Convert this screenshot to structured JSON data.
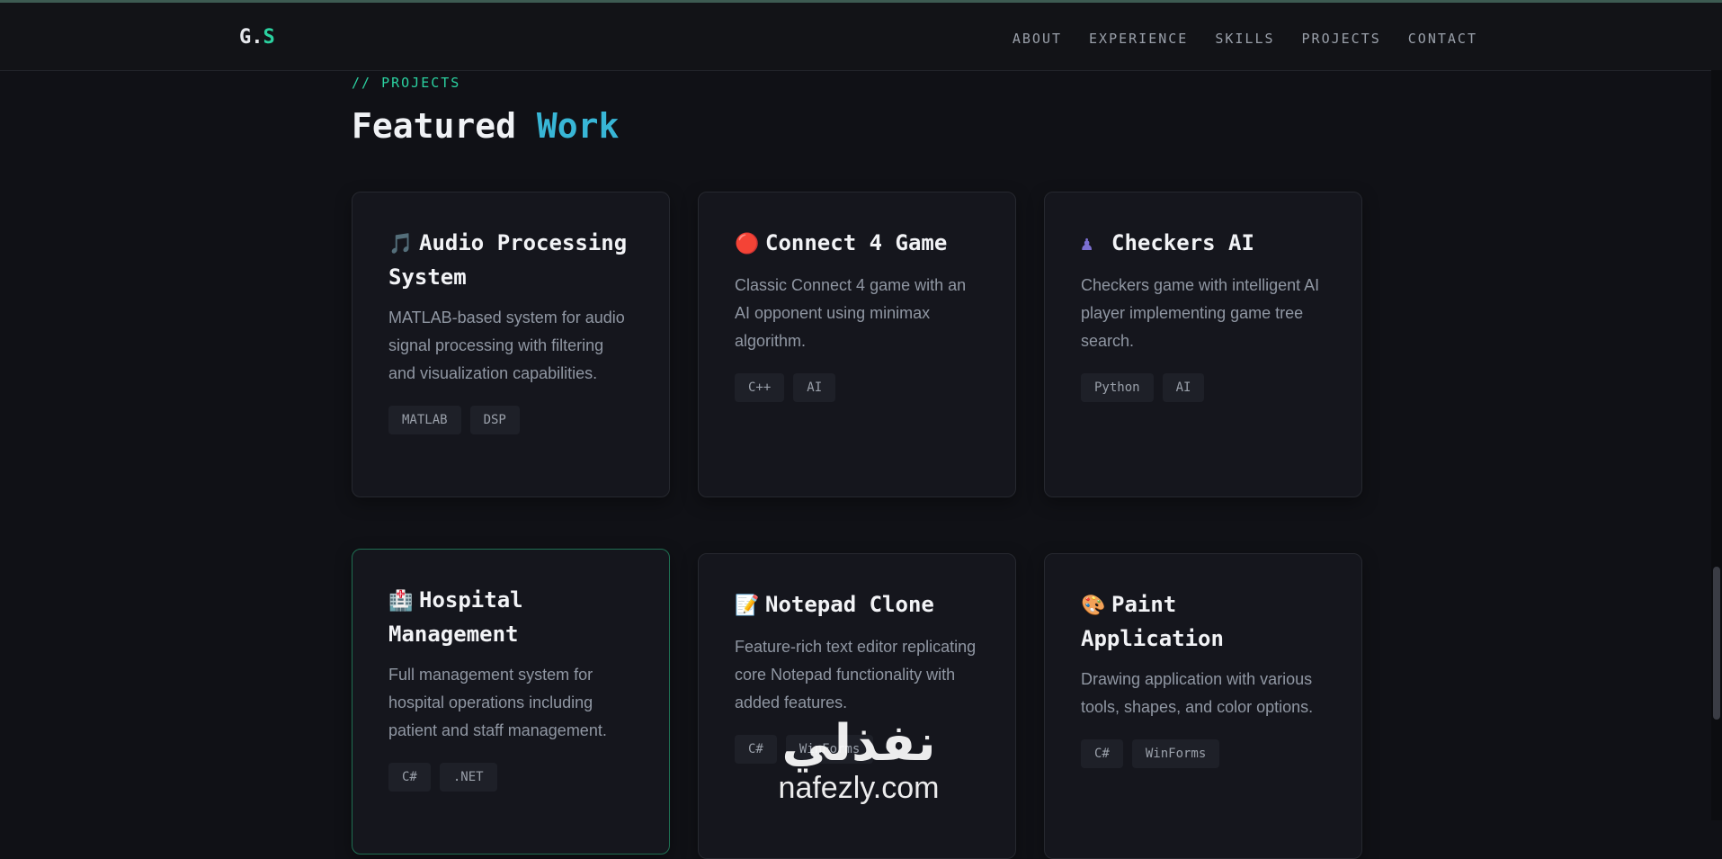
{
  "brand": {
    "logo_main": "G.",
    "logo_accent": "S"
  },
  "nav": [
    "ABOUT",
    "EXPERIENCE",
    "SKILLS",
    "PROJECTS",
    "CONTACT"
  ],
  "section": {
    "tag": "// PROJECTS",
    "title_main": "Featured",
    "title_accent": "Work"
  },
  "projects": [
    {
      "icon": "🎵",
      "icon_name": "music-note-icon",
      "title": "Audio Processing System",
      "description": "MATLAB-based system for audio signal processing with filtering and visualization capabilities.",
      "tags": [
        "MATLAB",
        "DSP"
      ]
    },
    {
      "icon": "🔴",
      "icon_name": "red-circle-icon",
      "title": "Connect 4 Game",
      "description": "Classic Connect 4 game with an AI opponent using minimax algorithm.",
      "tags": [
        "C++",
        "AI"
      ]
    },
    {
      "icon": "♟",
      "icon_name": "chess-pawn-icon",
      "title": "Checkers AI",
      "description": "Checkers game with intelligent AI player implementing game tree search.",
      "tags": [
        "Python",
        "AI"
      ]
    },
    {
      "icon": "🏥",
      "icon_name": "hospital-icon",
      "title": "Hospital Management",
      "description": "Full management system for hospital operations including patient and staff management.",
      "tags": [
        "C#",
        ".NET"
      ]
    },
    {
      "icon": "📝",
      "icon_name": "memo-icon",
      "title": "Notepad Clone",
      "description": "Feature-rich text editor replicating core Notepad functionality with added features.",
      "tags": [
        "C#",
        "WinForms"
      ]
    },
    {
      "icon": "🎨",
      "icon_name": "palette-icon",
      "title": "Paint Application",
      "description": "Drawing application with various tools, shapes, and color options.",
      "tags": [
        "C#",
        "WinForms"
      ]
    }
  ],
  "watermark": {
    "arabic": "نفذلي",
    "latin": "nafezly.com"
  },
  "colors": {
    "accent_green": "#2bd1a0",
    "accent_blue": "#38b6d6",
    "background": "#101116",
    "card": "#15161d"
  }
}
